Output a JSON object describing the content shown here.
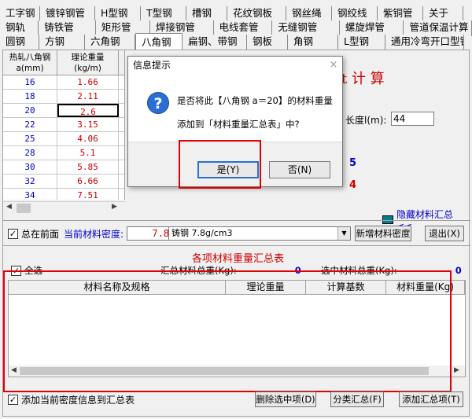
{
  "tabs": {
    "row1": [
      "工字钢",
      "镀锌钢管",
      "H型钢",
      "T型钢",
      "槽钢",
      "花纹钢板",
      "钢丝绳",
      "钢绞线",
      "紫铜管",
      "关于"
    ],
    "row2": [
      "钢轨",
      "铸铁管",
      "矩形管",
      "焊接钢管",
      "电线套管",
      "无缝钢管",
      "螺旋焊管",
      "管道保温计算"
    ],
    "row3": [
      "圆钢",
      "方钢",
      "六角钢",
      "八角钢",
      "扁钢、带钢",
      "钢板",
      "角钢",
      "L型钢",
      "通用冷弯开口型钢"
    ],
    "active": "八角钢"
  },
  "spec_table": {
    "headers": [
      "热轧八角钢\na(mm)",
      "理论重量\n(kg/m)"
    ],
    "rows": [
      {
        "a": "16",
        "w": "1.66"
      },
      {
        "a": "18",
        "w": "2.11"
      },
      {
        "a": "20",
        "w": "2.6"
      },
      {
        "a": "22",
        "w": "3.15"
      },
      {
        "a": "25",
        "w": "4.06"
      },
      {
        "a": "28",
        "w": "5.1"
      },
      {
        "a": "30",
        "w": "5.85"
      },
      {
        "a": "32",
        "w": "6.66"
      },
      {
        "a": "34",
        "w": "7.51"
      }
    ],
    "selected_index": 2
  },
  "calc": {
    "title_partial": "t 计 算",
    "length_label": "长度l(m):",
    "length_value": "44",
    "partial_blue": "5",
    "partial_red": "4",
    "hide_summary_link": "隐藏材料汇总<<"
  },
  "density": {
    "always_on_top_label": "总在前面",
    "current_density_label": "当前材料密度:",
    "density_value": "7.8",
    "material_select": "铸钢 7.8g/cm3",
    "new_density_button": "新增材料密度",
    "exit_button": "退出(X)"
  },
  "summary": {
    "title": "各项材料重量汇总表",
    "select_all_label": "全选",
    "total_label": "汇总材料总重(Kg):",
    "total_value": "0",
    "selected_total_label": "选中材料总重(Kg):",
    "selected_total_value": "0",
    "columns": [
      "材料名称及规格",
      "理论重量",
      "计算基数",
      "材料重量(Kg)"
    ]
  },
  "bottom": {
    "add_density_label": "添加当前密度信息到汇总表",
    "delete_button": "删除选中项(D)",
    "classify_button": "分类汇总(F)",
    "add_button": "添加汇总项(T)"
  },
  "dialog": {
    "title": "信息提示",
    "close": "×",
    "message_line1": "是否将此【八角钢 a＝20】的材料重量",
    "message_line2": "添加到「材料重量汇总表」中?",
    "yes_button": "是(Y)",
    "no_button": "否(N)",
    "icon_glyph": "?"
  },
  "colors": {
    "accent_red": "#cc0000",
    "accent_blue": "#0000cc",
    "highlight_frame": "#e00000"
  }
}
